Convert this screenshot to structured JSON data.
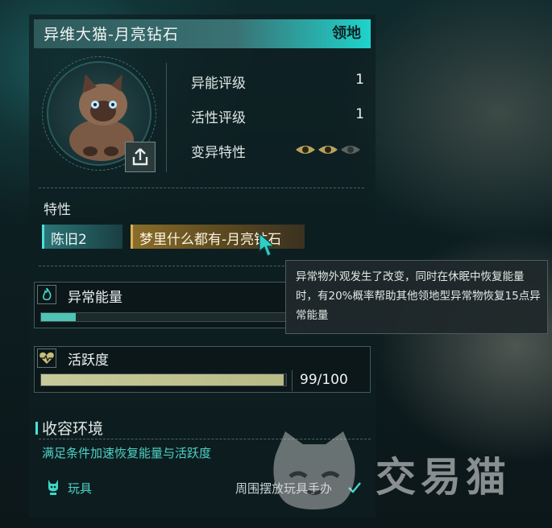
{
  "header": {
    "title": "异维大猫-月亮钻石",
    "tag": "领地"
  },
  "stats": [
    {
      "label": "异能评级",
      "value": "1"
    },
    {
      "label": "活性评级",
      "value": "1"
    },
    {
      "label": "变异特性",
      "value": ""
    }
  ],
  "mutation_eyes": {
    "active": 2,
    "total": 3
  },
  "traits": {
    "heading": "特性",
    "items": [
      {
        "label": "陈旧2",
        "style": "teal"
      },
      {
        "label": "梦里什么都有-月亮钻石",
        "style": "gold"
      }
    ]
  },
  "tooltip": {
    "text": "异常物外观发生了改变，同时在休眠中恢复能量时，有20%概率帮助其他领地型异常物恢复15点异常能量"
  },
  "energy": {
    "label": "异常能量",
    "fill_percent": 14,
    "color": "#4fc4b4"
  },
  "activity": {
    "label": "活跃度",
    "current": 99,
    "max": 100,
    "display": "99/100",
    "color": "#c8c99a"
  },
  "containment": {
    "heading": "收容环境",
    "description": "满足条件加速恢复能量与活跃度",
    "item_label": "玩具",
    "item_condition": "周围摆放玩具手办"
  },
  "watermark": {
    "text": "交易猫"
  },
  "colors": {
    "accent": "#1fd3cc",
    "gold": "#d7b156"
  }
}
